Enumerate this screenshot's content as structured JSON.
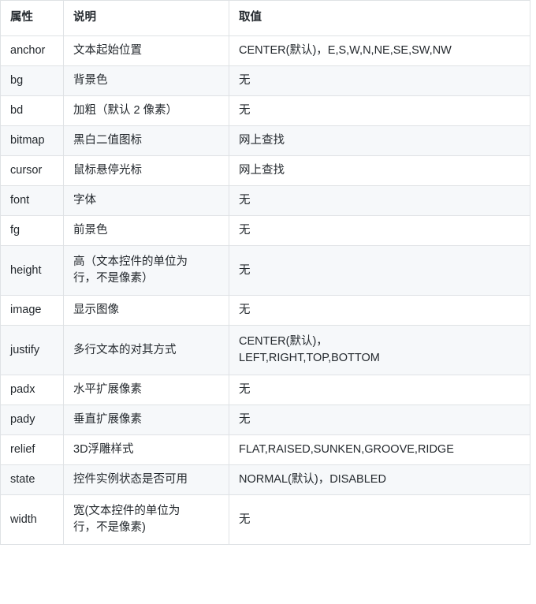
{
  "table": {
    "columns": [
      "属性",
      "说明",
      "取值"
    ],
    "rows": [
      {
        "attr": "anchor",
        "desc": "文本起始位置",
        "value": "CENTER(默认)，E,S,W,N,NE,SE,SW,NW",
        "tall": false
      },
      {
        "attr": "bg",
        "desc": "背景色",
        "value": "无",
        "tall": false
      },
      {
        "attr": "bd",
        "desc": "加粗（默认 2 像素）",
        "value": "无",
        "tall": false
      },
      {
        "attr": "bitmap",
        "desc": "黑白二值图标",
        "value": "网上查找",
        "tall": false
      },
      {
        "attr": "cursor",
        "desc": "鼠标悬停光标",
        "value": "网上查找",
        "tall": false
      },
      {
        "attr": "font",
        "desc": "字体",
        "value": "无",
        "tall": false
      },
      {
        "attr": "fg",
        "desc": "前景色",
        "value": "无",
        "tall": false
      },
      {
        "attr": "height",
        "desc": "高（文本控件的单位为\n行，不是像素）",
        "value": "无",
        "tall": true
      },
      {
        "attr": "image",
        "desc": "显示图像",
        "value": "无",
        "tall": false
      },
      {
        "attr": "justify",
        "desc": "多行文本的对其方式",
        "value": "CENTER(默认)，\nLEFT,RIGHT,TOP,BOTTOM",
        "tall": true
      },
      {
        "attr": "padx",
        "desc": "水平扩展像素",
        "value": "无",
        "tall": false
      },
      {
        "attr": "pady",
        "desc": "垂直扩展像素",
        "value": "无",
        "tall": false
      },
      {
        "attr": "relief",
        "desc": "3D浮雕样式",
        "value": "FLAT,RAISED,SUNKEN,GROOVE,RIDGE",
        "tall": false
      },
      {
        "attr": "state",
        "desc": "控件实例状态是否可用",
        "value": "NORMAL(默认)，DISABLED",
        "tall": false
      },
      {
        "attr": "width",
        "desc": "宽(文本控件的单位为\n行，不是像素)",
        "value": "无",
        "tall": true
      }
    ]
  },
  "colors": {
    "border": "#dfe2e5",
    "stripe": "#f6f8fa",
    "text": "#24292e",
    "background": "#ffffff"
  }
}
